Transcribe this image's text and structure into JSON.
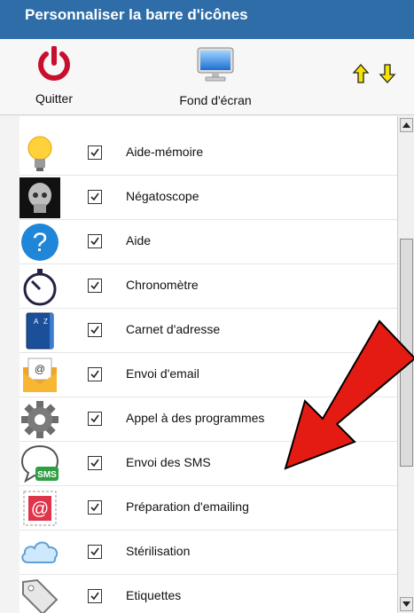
{
  "window": {
    "title": "Personnaliser la barre d'icônes"
  },
  "toolbar": {
    "quit_label": "Quitter",
    "wallpaper_label": "Fond d'écran",
    "up_icon": "arrow-up-icon",
    "down_icon": "arrow-down-icon"
  },
  "list": {
    "items": [
      {
        "label": "Aide-mémoire",
        "checked": true,
        "icon": "lightbulb-icon"
      },
      {
        "label": "Négatoscope",
        "checked": true,
        "icon": "xray-skull-icon"
      },
      {
        "label": "Aide",
        "checked": true,
        "icon": "help-icon"
      },
      {
        "label": "Chronomètre",
        "checked": true,
        "icon": "stopwatch-icon"
      },
      {
        "label": "Carnet d'adresse",
        "checked": true,
        "icon": "address-book-icon"
      },
      {
        "label": "Envoi d'email",
        "checked": true,
        "icon": "email-envelope-icon"
      },
      {
        "label": "Appel à des programmes",
        "checked": true,
        "icon": "gear-icon"
      },
      {
        "label": "Envoi des SMS",
        "checked": true,
        "icon": "sms-bubble-icon"
      },
      {
        "label": "Préparation d'emailing",
        "checked": true,
        "icon": "emailing-stamp-icon"
      },
      {
        "label": "Stérilisation",
        "checked": true,
        "icon": "cloud-icon"
      },
      {
        "label": "Etiquettes",
        "checked": true,
        "icon": "tag-icon"
      }
    ],
    "sms_badge": "SMS"
  },
  "colors": {
    "titlebar": "#2f6da8",
    "annotation_arrow": "#e41b12"
  }
}
